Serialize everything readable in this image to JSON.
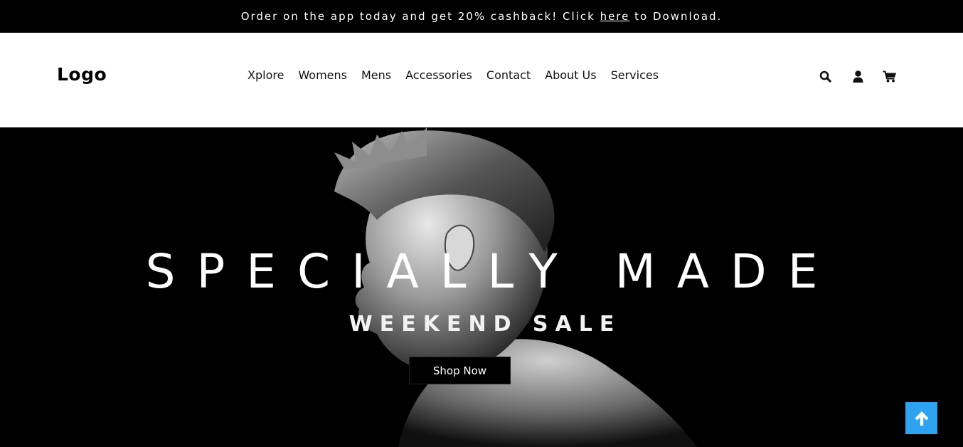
{
  "announcement": {
    "before": "Order on the app today and get 20% cashback! Click",
    "link": "here",
    "after": "to Download."
  },
  "header": {
    "logo": "Logo",
    "nav": [
      "Xplore",
      "Womens",
      "Mens",
      "Accessories",
      "Contact",
      "About Us",
      "Services"
    ],
    "icons": [
      "search-icon",
      "user-icon",
      "cart-icon"
    ]
  },
  "hero": {
    "title": "SPECIALLY MADE",
    "subtitle": "WEEKEND SALE",
    "cta": "Shop Now"
  },
  "colors": {
    "announcement_bg": "#000000",
    "header_bg": "#ffffff",
    "hero_bg": "#000000",
    "back_to_top_bg": "#2ea3f2"
  }
}
